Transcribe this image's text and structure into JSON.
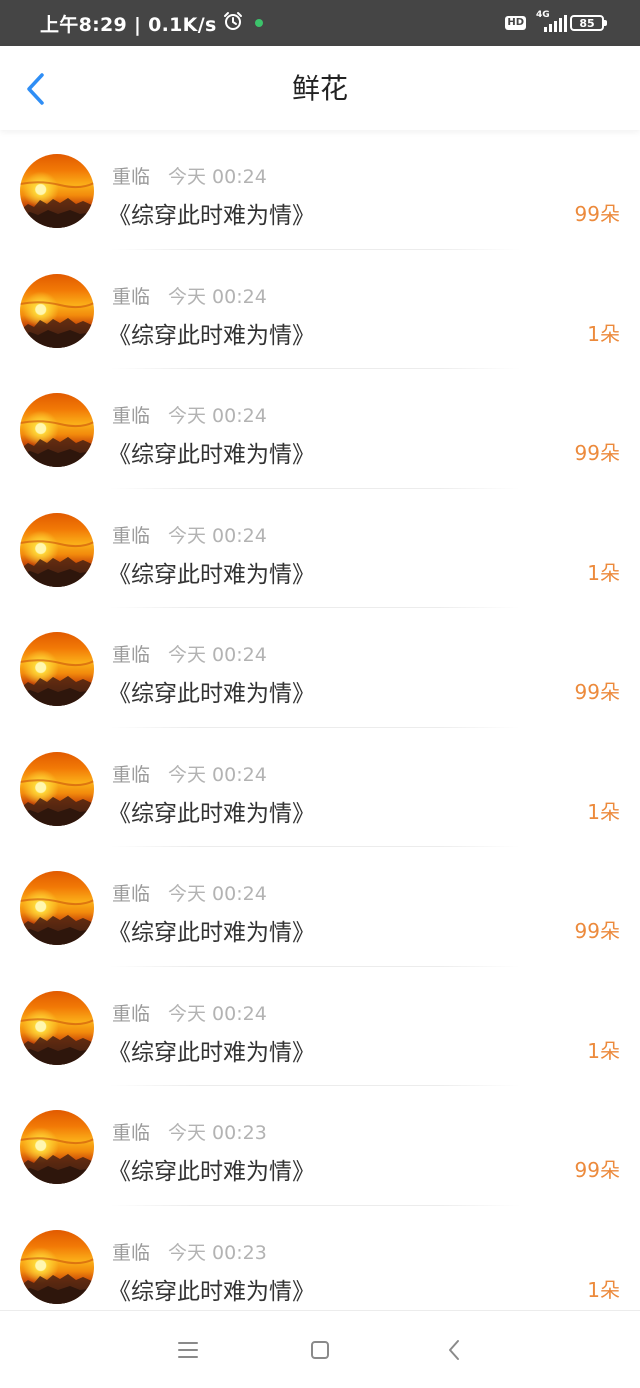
{
  "status_bar": {
    "time_speed": "上午8:29 | 0.1K/s",
    "hd": "HD",
    "network": "4G",
    "battery": "85"
  },
  "header": {
    "title": "鲜花"
  },
  "items": [
    {
      "user": "重临",
      "time": "今天 00:24",
      "book": "《综穿此时难为情》",
      "count": "99朵"
    },
    {
      "user": "重临",
      "time": "今天 00:24",
      "book": "《综穿此时难为情》",
      "count": "1朵"
    },
    {
      "user": "重临",
      "time": "今天 00:24",
      "book": "《综穿此时难为情》",
      "count": "99朵"
    },
    {
      "user": "重临",
      "time": "今天 00:24",
      "book": "《综穿此时难为情》",
      "count": "1朵"
    },
    {
      "user": "重临",
      "time": "今天 00:24",
      "book": "《综穿此时难为情》",
      "count": "99朵"
    },
    {
      "user": "重临",
      "time": "今天 00:24",
      "book": "《综穿此时难为情》",
      "count": "1朵"
    },
    {
      "user": "重临",
      "time": "今天 00:24",
      "book": "《综穿此时难为情》",
      "count": "99朵"
    },
    {
      "user": "重临",
      "time": "今天 00:24",
      "book": "《综穿此时难为情》",
      "count": "1朵"
    },
    {
      "user": "重临",
      "time": "今天 00:23",
      "book": "《综穿此时难为情》",
      "count": "99朵"
    },
    {
      "user": "重临",
      "time": "今天 00:23",
      "book": "《综穿此时难为情》",
      "count": "1朵"
    }
  ],
  "colors": {
    "accent_blue": "#2f8ef5",
    "count_orange": "#ec8a3c",
    "status_bar_bg": "#454545"
  },
  "icons": {
    "back": "chevron-left-icon",
    "alarm": "alarm-clock-icon",
    "nav_menu": "menu-icon",
    "nav_home": "square-home-icon",
    "nav_back": "triangle-back-icon"
  }
}
